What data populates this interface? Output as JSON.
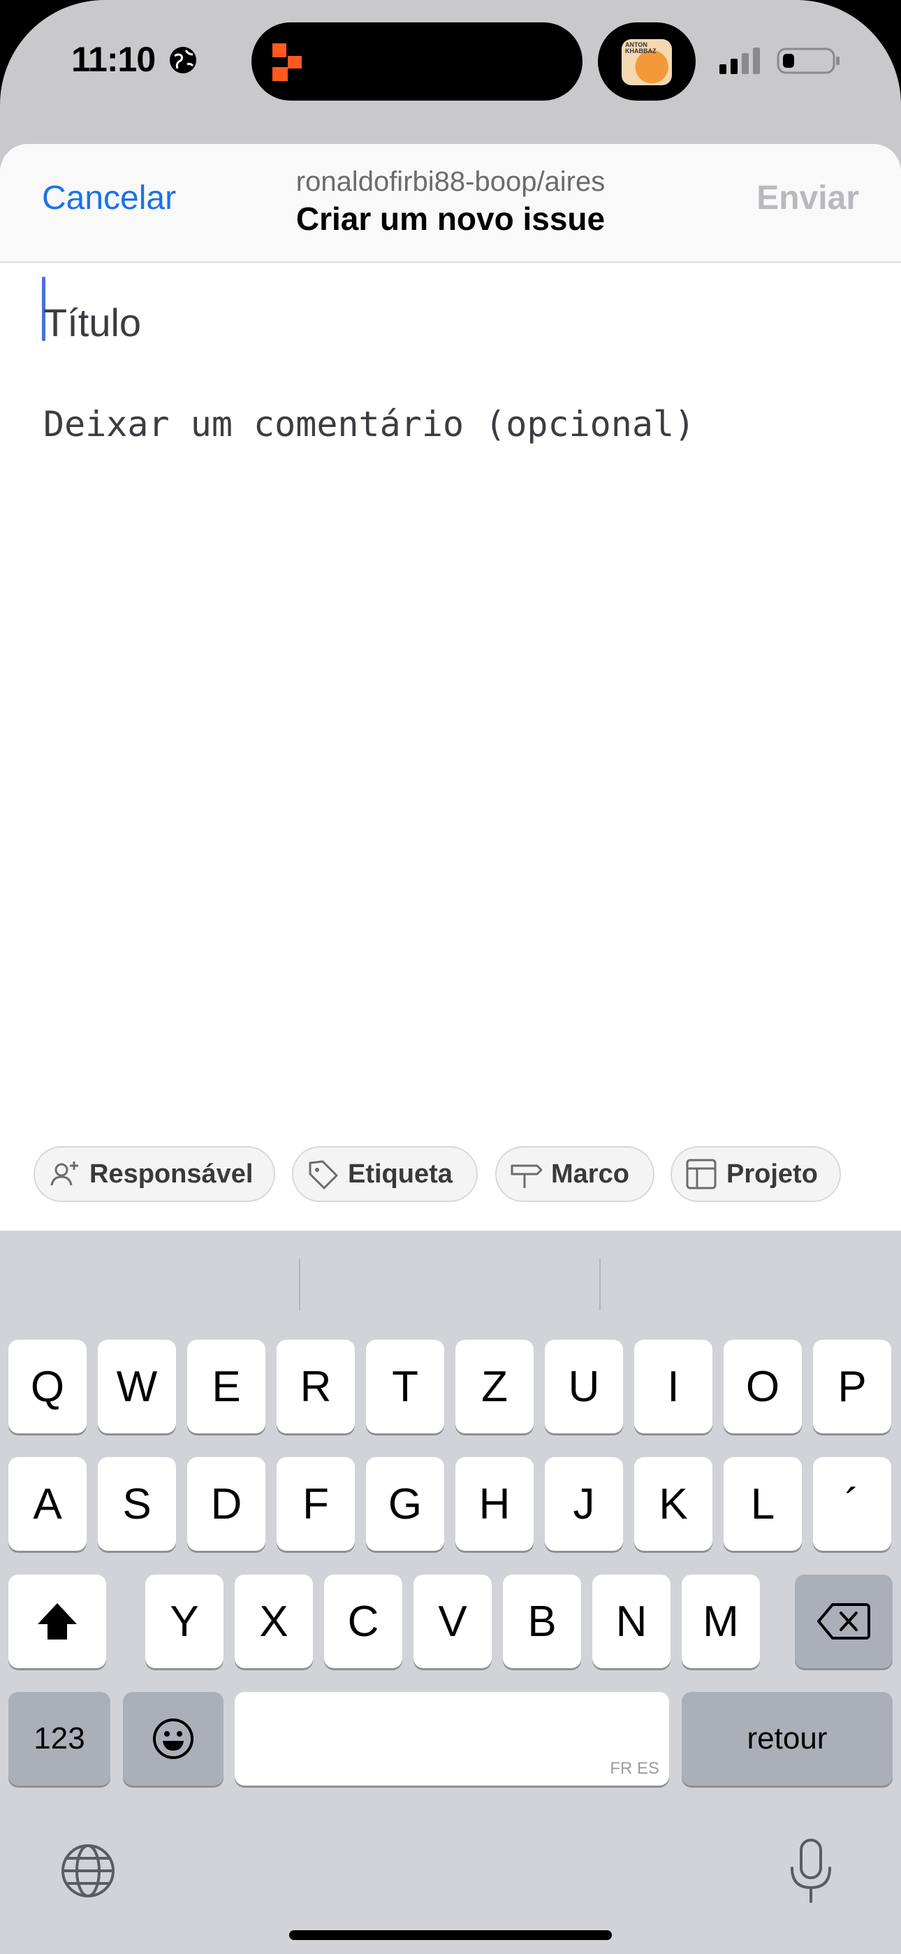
{
  "status_bar": {
    "time": "11:10",
    "album_art_text": "ANTON KHABBAZ",
    "icons": [
      "globe-icon",
      "app-activity-icon",
      "cellular-signal-icon",
      "battery-icon"
    ]
  },
  "header": {
    "cancel_label": "Cancelar",
    "repo": "ronaldofirbi88-boop/aires",
    "title": "Criar um novo issue",
    "send_label": "Enviar"
  },
  "form": {
    "title_placeholder": "Título",
    "title_value": "",
    "comment_placeholder": "Deixar um comentário (opcional)",
    "comment_value": ""
  },
  "chips": [
    {
      "label": "Responsável",
      "icon": "person-add-icon"
    },
    {
      "label": "Etiqueta",
      "icon": "tag-icon"
    },
    {
      "label": "Marco",
      "icon": "milestone-icon"
    },
    {
      "label": "Projeto",
      "icon": "project-table-icon"
    }
  ],
  "keyboard": {
    "row1": [
      "Q",
      "W",
      "E",
      "R",
      "T",
      "Z",
      "U",
      "I",
      "O",
      "P"
    ],
    "row2": [
      "A",
      "S",
      "D",
      "F",
      "G",
      "H",
      "J",
      "K",
      "L",
      "´"
    ],
    "row3": [
      "Y",
      "X",
      "C",
      "V",
      "B",
      "N",
      "M"
    ],
    "numbers_label": "123",
    "return_label": "retour",
    "space_languages": "FR ES"
  },
  "colors": {
    "accent": "#1a73e8",
    "send_disabled": "#b9b9bd",
    "caret": "#4a6fdc",
    "keyboard_bg": "#d1d3d9"
  }
}
